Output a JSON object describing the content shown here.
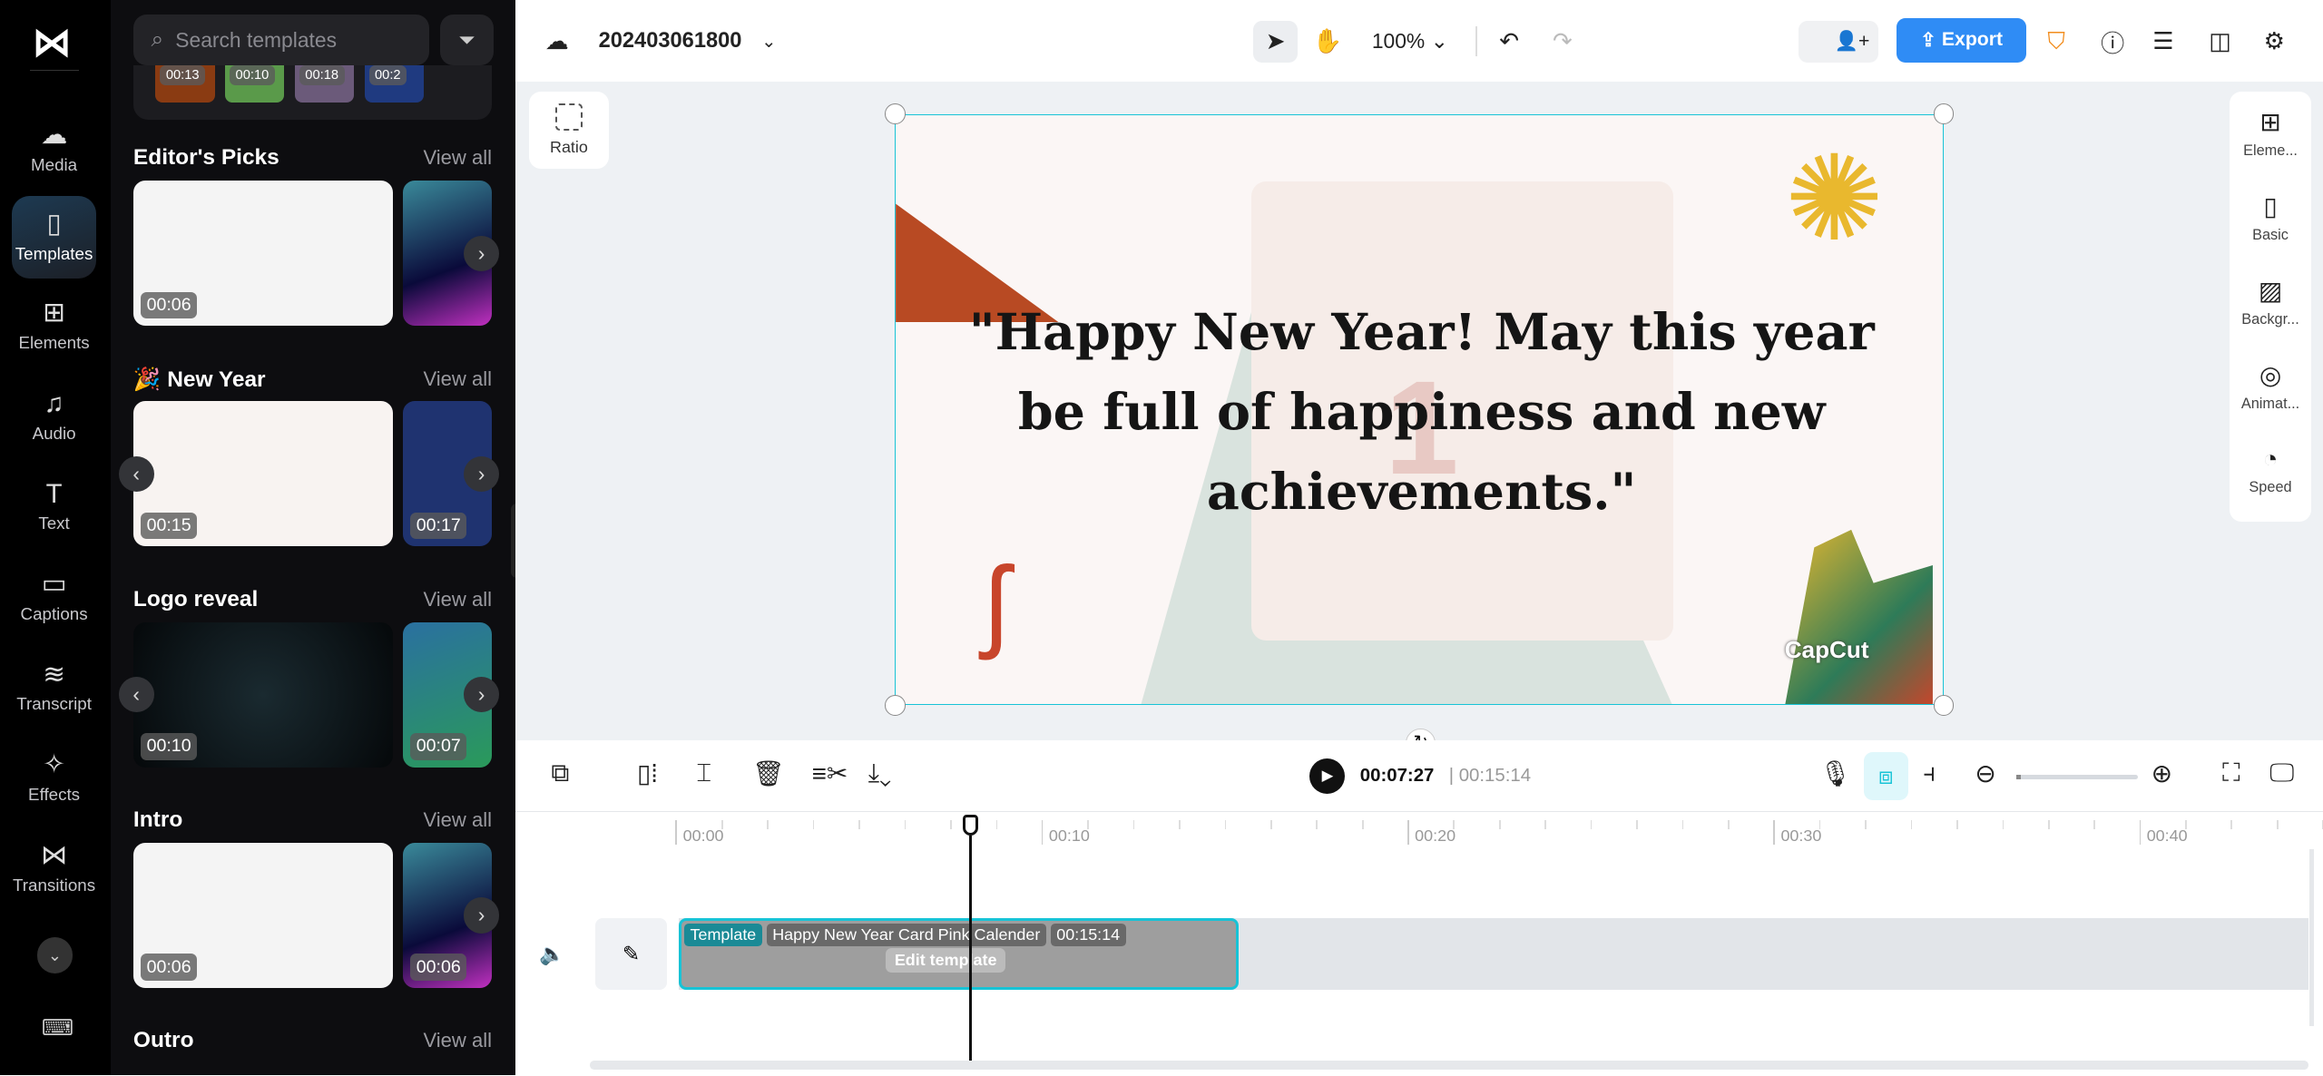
{
  "rail": {
    "items": [
      {
        "label": "Media",
        "icon": "cloud-upload-icon"
      },
      {
        "label": "Templates",
        "icon": "templates-icon",
        "active": true
      },
      {
        "label": "Elements",
        "icon": "elements-icon"
      },
      {
        "label": "Audio",
        "icon": "music-note-icon"
      },
      {
        "label": "Text",
        "icon": "text-icon"
      },
      {
        "label": "Captions",
        "icon": "captions-icon"
      },
      {
        "label": "Transcript",
        "icon": "transcript-icon"
      },
      {
        "label": "Effects",
        "icon": "effects-icon"
      },
      {
        "label": "Transitions",
        "icon": "transitions-icon"
      }
    ]
  },
  "panel": {
    "search_placeholder": "Search templates",
    "top_strip": [
      "00:13",
      "00:10",
      "00:18",
      "00:2"
    ],
    "sections": [
      {
        "title": "Editor's Picks",
        "view_all": "View all",
        "cards": [
          "00:06",
          ""
        ]
      },
      {
        "title": "New Year",
        "emoji": "🎉",
        "view_all": "View all",
        "cards": [
          "00:15",
          "00:17"
        ]
      },
      {
        "title": "Logo reveal",
        "view_all": "View all",
        "cards": [
          "00:10",
          "00:07"
        ]
      },
      {
        "title": "Intro",
        "view_all": "View all",
        "cards": [
          "00:06",
          "00:06"
        ]
      },
      {
        "title": "Outro",
        "view_all": "View all",
        "cards": []
      }
    ]
  },
  "topbar": {
    "project_name": "202403061800",
    "zoom": "100%",
    "export_label": "Export"
  },
  "canvas": {
    "ratio_label": "Ratio",
    "quote": "\"Happy New Year! May this year be full of happiness and new achievements.\"",
    "watermark": "CapCut"
  },
  "right_panel": [
    {
      "label": "Eleme...",
      "icon": "elements-icon"
    },
    {
      "label": "Basic",
      "icon": "basic-icon"
    },
    {
      "label": "Backgr...",
      "icon": "background-icon"
    },
    {
      "label": "Animat...",
      "icon": "animation-icon"
    },
    {
      "label": "Speed",
      "icon": "speed-icon"
    }
  ],
  "player": {
    "current": "00:07:27",
    "total": "00:15:14"
  },
  "timeline": {
    "ticks": [
      "00:00",
      "00:10",
      "00:20",
      "00:30",
      "00:40"
    ],
    "clip": {
      "tag": "Template",
      "name": "Happy New Year Card Pink Calender",
      "duration": "00:15:14",
      "edit_label": "Edit template"
    }
  },
  "colors": {
    "accent": "#2f8cf5",
    "selection": "#17c3d6"
  }
}
